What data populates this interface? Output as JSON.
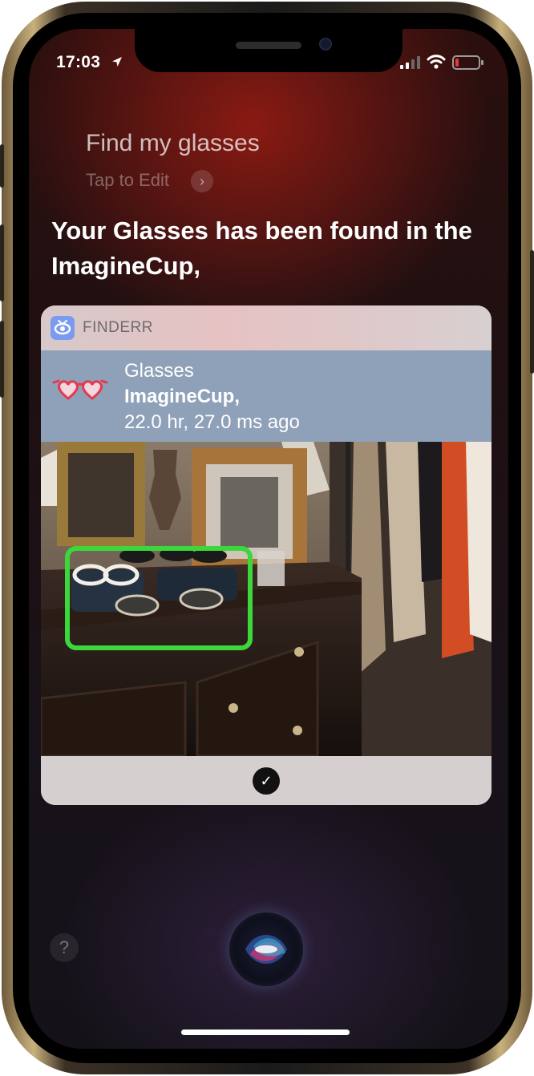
{
  "status_bar": {
    "time": "17:03",
    "icons": [
      "location-arrow-icon",
      "cellular-signal-icon",
      "wifi-icon",
      "battery-low-icon"
    ],
    "battery_color": "#e5383b"
  },
  "siri": {
    "query": "Find my glasses",
    "tap_to_edit": "Tap to Edit",
    "chevron": "›",
    "response": "Your Glasses has been found in the ImagineCup,"
  },
  "card": {
    "app_name": "FINDERR",
    "item_title": "Glasses",
    "item_location": "ImagineCup,",
    "item_time": "22.0 hr, 27.0 ms ago",
    "detection_color": "#3bd73b",
    "confirm_icon": "checkmark-icon",
    "confirm_symbol": "✓"
  },
  "help_symbol": "?",
  "colors": {
    "accent_head": "#e6c2c3",
    "result_row": "#8fa1b9"
  }
}
